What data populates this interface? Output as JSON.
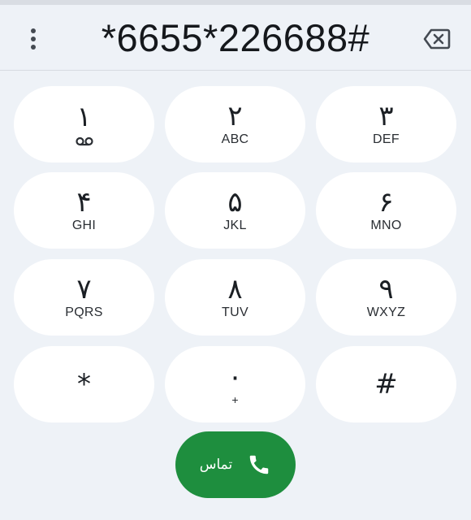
{
  "dialer": {
    "number": "*6655*226688#",
    "keys": [
      {
        "digit": "۱",
        "letters": ""
      },
      {
        "digit": "۲",
        "letters": "ABC"
      },
      {
        "digit": "۳",
        "letters": "DEF"
      },
      {
        "digit": "۴",
        "letters": "GHI"
      },
      {
        "digit": "۵",
        "letters": "JKL"
      },
      {
        "digit": "۶",
        "letters": "MNO"
      },
      {
        "digit": "۷",
        "letters": "PQRS"
      },
      {
        "digit": "۸",
        "letters": "TUV"
      },
      {
        "digit": "۹",
        "letters": "WXYZ"
      },
      {
        "digit": "*",
        "letters": ""
      },
      {
        "digit": "۰",
        "letters": "+"
      },
      {
        "digit": "#",
        "letters": ""
      }
    ],
    "call_label": "تماس"
  },
  "icons": {
    "menu": "more-vert-icon",
    "backspace": "backspace-icon",
    "voicemail": "voicemail-icon",
    "call": "phone-icon"
  },
  "colors": {
    "background": "#eef2f7",
    "key": "#ffffff",
    "call_button": "#1e8e3e"
  }
}
